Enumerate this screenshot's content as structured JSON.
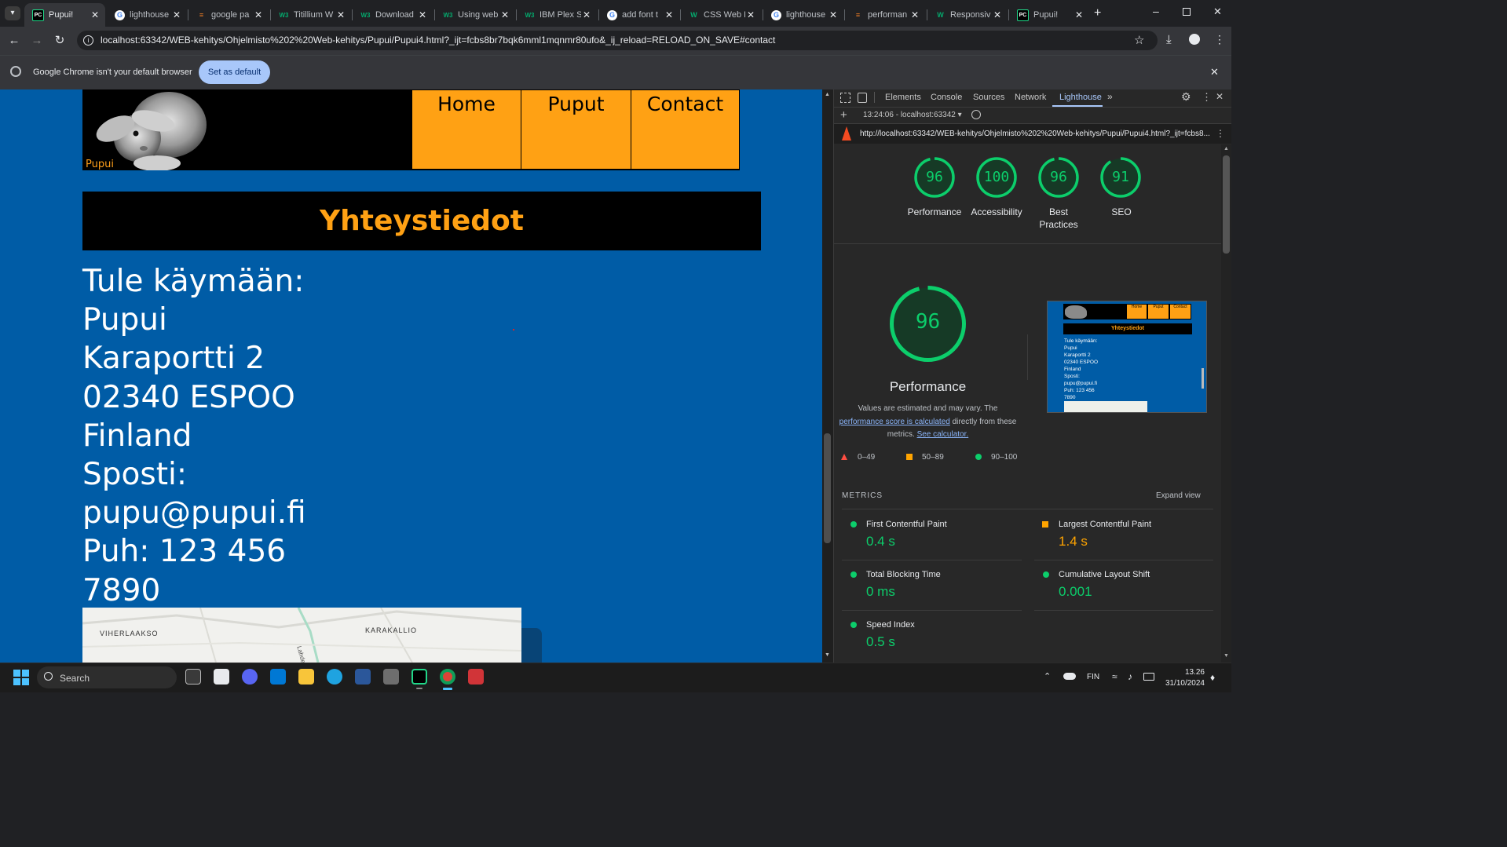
{
  "browser": {
    "tabs": [
      {
        "title": "Pupui!",
        "icon": "pycharm-icon",
        "active": true
      },
      {
        "title": "lighthouse",
        "icon": "google-icon"
      },
      {
        "title": "google pa",
        "icon": "stackoverflow-icon"
      },
      {
        "title": "Titillium W",
        "icon": "w3schools-icon"
      },
      {
        "title": "Download",
        "icon": "w3schools-icon"
      },
      {
        "title": "Using web",
        "icon": "w3schools-icon"
      },
      {
        "title": "IBM Plex S",
        "icon": "w3schools-icon"
      },
      {
        "title": "add font t",
        "icon": "google-icon"
      },
      {
        "title": "CSS Web F",
        "icon": "w3-icon"
      },
      {
        "title": "lighthouse",
        "icon": "google-icon"
      },
      {
        "title": "performan",
        "icon": "stackoverflow-icon"
      },
      {
        "title": "Responsiv",
        "icon": "w3-icon"
      },
      {
        "title": "Pupui!",
        "icon": "pycharm-icon"
      }
    ],
    "url": "localhost:63342/WEB-kehitys/Ohjelmisto%202%20Web-kehitys/Pupui/Pupui4.html?_ijt=fcbs8br7bqk6mml1mqnmr80ufo&_ij_reload=RELOAD_ON_SAVE#contact",
    "infobar": {
      "message": "Google Chrome isn't your default browser",
      "button": "Set as default"
    }
  },
  "site": {
    "logo_text": "Pupui",
    "nav": [
      "Home",
      "Puput",
      "Contact"
    ],
    "section_title": "Yhteystiedot",
    "contact_lines": [
      "Tule käymään:",
      "Pupui",
      "Karaportti 2",
      "02340 ESPOO",
      "Finland",
      "Sposti:",
      "pupu@pupui.fi",
      "Puh: 123 456",
      "7890"
    ],
    "map_labels": [
      "VIHERLAAKSO",
      "KARAKALLIO",
      "Lahdent"
    ]
  },
  "devtools": {
    "tabs": [
      "Elements",
      "Console",
      "Sources",
      "Network",
      "Lighthouse"
    ],
    "active_tab": "Lighthouse",
    "report_select": "13:24:06 - localhost:63342",
    "report_url": "http://localhost:63342/WEB-kehitys/Ohjelmisto%202%20Web-kehitys/Pupui/Pupui4.html?_ijt=fcbs8...",
    "scores": [
      {
        "label": "Performance",
        "value": 96
      },
      {
        "label": "Accessibility",
        "value": 100
      },
      {
        "label": "Best Practices",
        "value": 96
      },
      {
        "label": "SEO",
        "value": 91
      }
    ],
    "main_score": 96,
    "main_label": "Performance",
    "note_1": "Values are estimated and may vary. The",
    "note_link": "performance score is calculated",
    "note_2": "directly from these",
    "note_3": "metrics.",
    "note_link2": "See calculator.",
    "legend": [
      "0–49",
      "50–89",
      "90–100"
    ],
    "metrics_header": "METRICS",
    "expand_view": "Expand view",
    "metrics": [
      {
        "name": "First Contentful Paint",
        "value": "0.4 s",
        "status": "good"
      },
      {
        "name": "Largest Contentful Paint",
        "value": "1.4 s",
        "status": "average"
      },
      {
        "name": "Total Blocking Time",
        "value": "0 ms",
        "status": "good"
      },
      {
        "name": "Cumulative Layout Shift",
        "value": "0.001",
        "status": "good"
      },
      {
        "name": "Speed Index",
        "value": "0.5 s",
        "status": "good"
      }
    ],
    "thumbnail": {
      "nav": [
        "Home",
        "Puput",
        "Contact"
      ],
      "title": "Yhteystiedot",
      "lines": [
        "Tule käymään:",
        "Pupui",
        "Karaportti 2",
        "02340 ESPOO",
        "Finland",
        "Sposti:",
        "pupu@pupui.fi",
        "Puh: 123 456",
        "7890"
      ]
    }
  },
  "taskbar": {
    "search": "Search",
    "language": "FIN",
    "time": "13.26",
    "date": "31/10/2024"
  },
  "colors": {
    "page_bg": "#005ca6",
    "accent_orange": "#ffa114",
    "good": "#0cce6b",
    "average": "#ffa400",
    "poor": "#ff4e42"
  }
}
